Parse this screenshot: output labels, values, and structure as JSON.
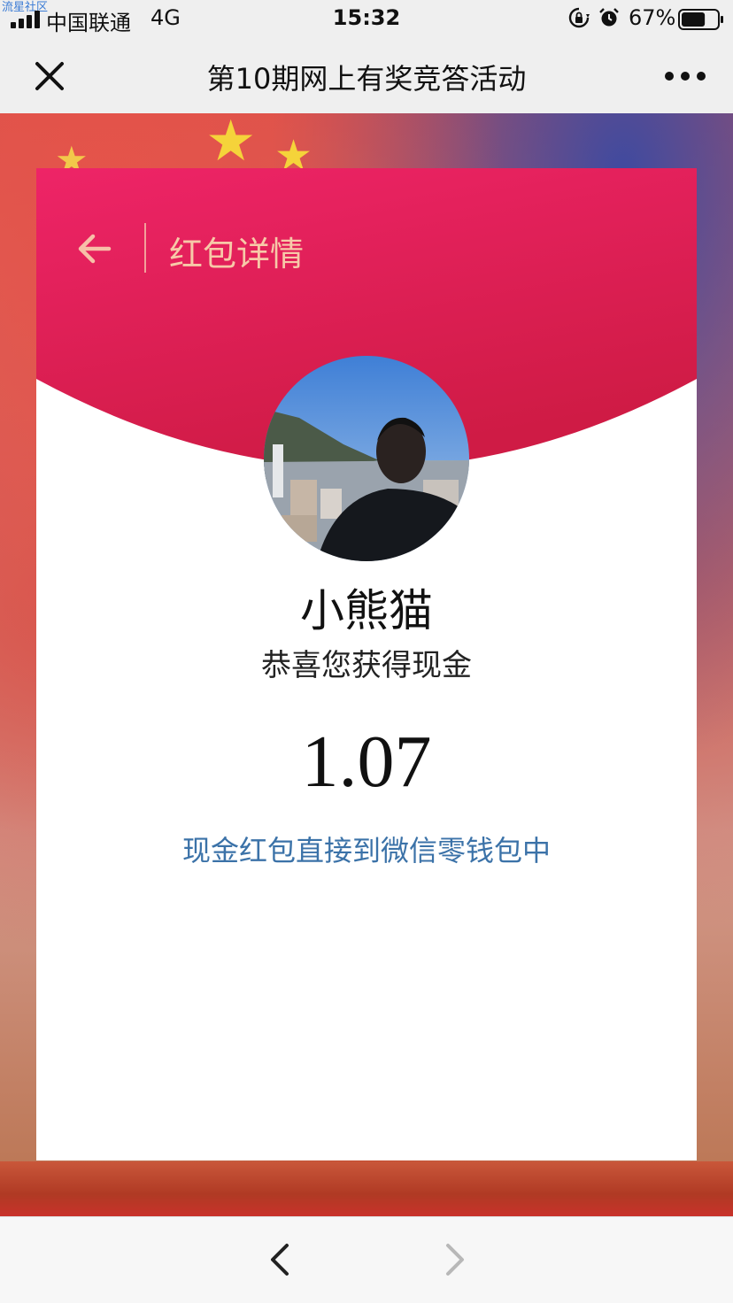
{
  "status_bar": {
    "watermark": "流星社区",
    "carrier": "中国联通",
    "network": "4G",
    "time": "15:32",
    "battery_percent": "67%",
    "battery_level": 0.67,
    "icons": [
      "signal-icon",
      "orientation-lock-icon",
      "alarm-icon",
      "battery-icon"
    ]
  },
  "nav_bar": {
    "title": "第10期网上有奖竞答活动",
    "icons": [
      "close-icon",
      "more-icon"
    ]
  },
  "card": {
    "header_title": "红包详情",
    "user_name": "小熊猫",
    "congrats_text": "恭喜您获得现金",
    "amount": "1.07",
    "wallet_note": "现金红包直接到微信零钱包中",
    "icons": [
      "back-arrow-icon",
      "avatar-photo"
    ]
  },
  "bottom_bar": {
    "icons": [
      "chevron-left-icon",
      "chevron-right-icon"
    ],
    "back_enabled": true,
    "forward_enabled": false
  },
  "colors": {
    "header_red": "#e8245f",
    "header_red_dark": "#d01c48",
    "header_title": "#f7c9a8",
    "wallet_note": "#3b72a8",
    "bar_background": "#efefef"
  }
}
